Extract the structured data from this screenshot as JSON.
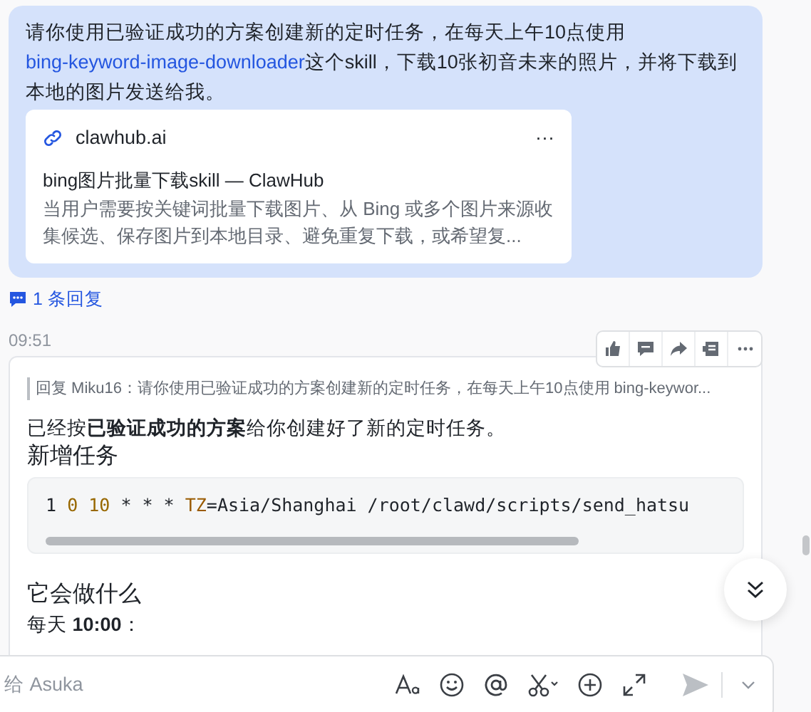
{
  "user_message": {
    "text_before": "请你使用已验证成功的方案创建新的定时任务，在每天上午10点使用",
    "link": "bing-keyword-image-downloader",
    "text_after": "这个skill，下载10张初音未来的照片，并将下载到本地的图片发送给我。",
    "link_card": {
      "domain": "clawhub.ai",
      "more": "···",
      "title": "bing图片批量下载skill — ClawHub",
      "description": "当用户需要按关键词批量下载图片、从 Bing 或多个图片来源收集候选、保存图片到本地目录、避免重复下载，或希望复..."
    }
  },
  "reply_count": "1 条回复",
  "bot_message": {
    "time": "09:51",
    "toolbar": [
      {
        "kind": "like"
      },
      {
        "kind": "comment"
      },
      {
        "kind": "forward"
      },
      {
        "kind": "pin"
      },
      {
        "kind": "more"
      }
    ],
    "quote": "回复 Miku16：请你使用已验证成功的方案创建新的定时任务，在每天上午10点使用 bing-keywor...",
    "blocks": [
      {
        "kind": "paragraph",
        "text": "已经按**已验证成功的方案**给你创建好了新的定时任务。"
      },
      {
        "kind": "heading",
        "text": "新增任务"
      },
      {
        "kind": "code",
        "tokens": [
          {
            "text": "1 ",
            "kind": "plain"
          },
          {
            "text": "0 10",
            "kind": "number"
          },
          {
            "text": " * * * ",
            "kind": "plain"
          },
          {
            "text": "TZ",
            "kind": "keyword"
          },
          {
            "text": "=Asia/Shanghai /root/clawd/scripts/send_hatsu",
            "kind": "plain"
          }
        ]
      },
      {
        "kind": "heading",
        "text": "它会做什么"
      },
      {
        "kind": "paragraph",
        "text": "每天 **10:00**："
      }
    ]
  },
  "composer": {
    "placeholder": "给 Asuka",
    "tools": [
      {
        "kind": "font"
      },
      {
        "kind": "emoji"
      },
      {
        "kind": "mention"
      },
      {
        "kind": "scissors"
      },
      {
        "kind": "add"
      },
      {
        "kind": "expand"
      }
    ]
  }
}
